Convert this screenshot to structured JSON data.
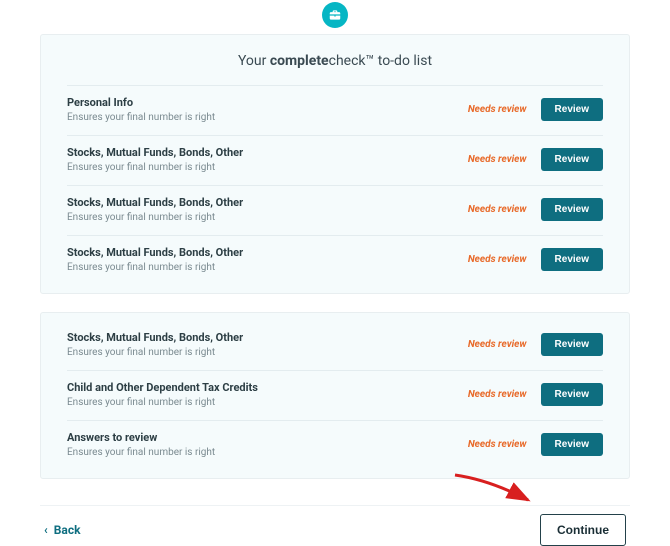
{
  "header": {
    "icon": "briefcase-icon",
    "title_prefix": "Your ",
    "title_bold": "complete",
    "title_mid": "check™",
    "title_suffix": " to-do list"
  },
  "status_label": "Needs review",
  "review_label": "Review",
  "group1": [
    {
      "title": "Personal Info",
      "sub": "Ensures your final number is right"
    },
    {
      "title": "Stocks, Mutual Funds, Bonds, Other",
      "sub": "Ensures your final number is right"
    },
    {
      "title": "Stocks, Mutual Funds, Bonds, Other",
      "sub": "Ensures your final number is right"
    },
    {
      "title": "Stocks, Mutual Funds, Bonds, Other",
      "sub": "Ensures your final number is right"
    }
  ],
  "group2": [
    {
      "title": "Stocks, Mutual Funds, Bonds, Other",
      "sub": "Ensures your final number is right"
    },
    {
      "title": "Child and Other Dependent Tax Credits",
      "sub": "Ensures your final number is right"
    },
    {
      "title": "Answers to review",
      "sub": "Ensures your final number is right"
    }
  ],
  "footer": {
    "back": "Back",
    "continue": "Continue"
  }
}
